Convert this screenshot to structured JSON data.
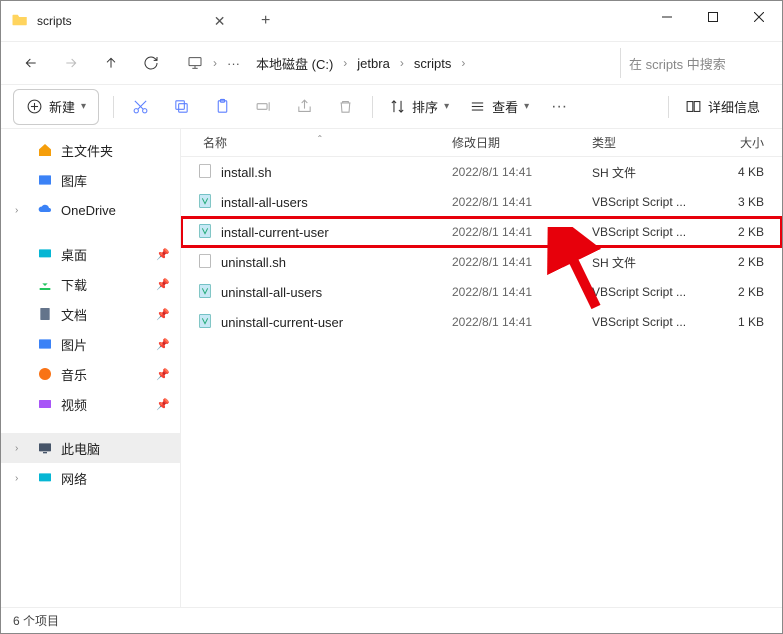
{
  "tab": {
    "title": "scripts"
  },
  "breadcrumb": {
    "ellipsis": "···",
    "items": [
      "本地磁盘 (C:)",
      "jetbra",
      "scripts"
    ]
  },
  "search": {
    "placeholder": "在 scripts 中搜索"
  },
  "toolbar": {
    "new": "新建",
    "sort": "排序",
    "view": "查看",
    "details": "详细信息"
  },
  "columns": {
    "name": "名称",
    "date": "修改日期",
    "type": "类型",
    "size": "大小"
  },
  "sidebar": {
    "home": "主文件夹",
    "gallery": "图库",
    "onedrive": "OneDrive",
    "desktop": "桌面",
    "downloads": "下载",
    "documents": "文档",
    "pictures": "图片",
    "music": "音乐",
    "videos": "视频",
    "thispc": "此电脑",
    "network": "网络"
  },
  "files": [
    {
      "name": "install.sh",
      "date": "2022/8/1 14:41",
      "type": "SH 文件",
      "size": "4 KB",
      "icon": "sh"
    },
    {
      "name": "install-all-users",
      "date": "2022/8/1 14:41",
      "type": "VBScript Script ...",
      "size": "3 KB",
      "icon": "vbs"
    },
    {
      "name": "install-current-user",
      "date": "2022/8/1 14:41",
      "type": "VBScript Script ...",
      "size": "2 KB",
      "icon": "vbs",
      "highlight": true
    },
    {
      "name": "uninstall.sh",
      "date": "2022/8/1 14:41",
      "type": "SH 文件",
      "size": "2 KB",
      "icon": "sh"
    },
    {
      "name": "uninstall-all-users",
      "date": "2022/8/1 14:41",
      "type": "VBScript Script ...",
      "size": "2 KB",
      "icon": "vbs"
    },
    {
      "name": "uninstall-current-user",
      "date": "2022/8/1 14:41",
      "type": "VBScript Script ...",
      "size": "1 KB",
      "icon": "vbs"
    }
  ],
  "status": "6 个项目"
}
